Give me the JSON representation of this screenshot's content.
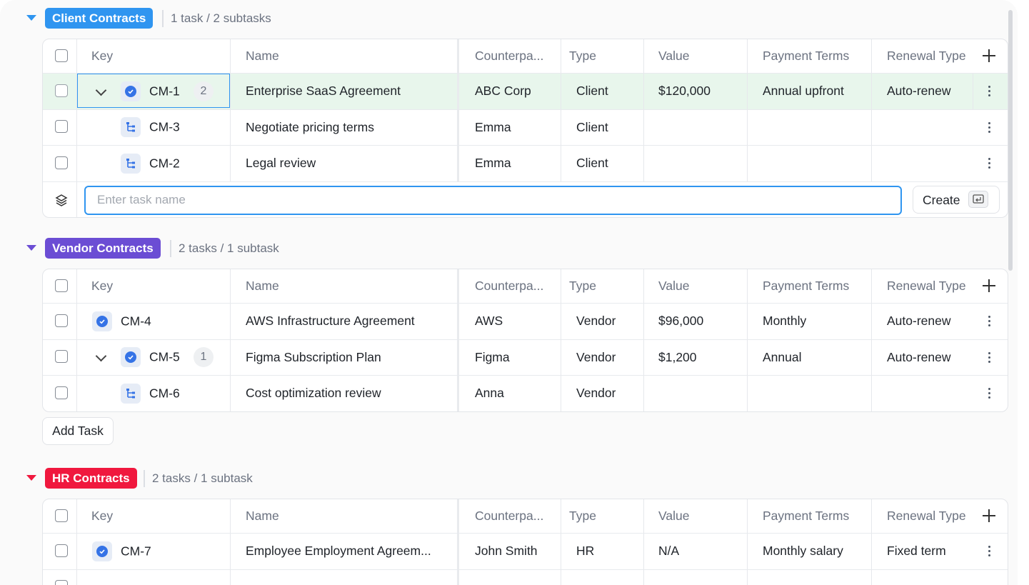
{
  "colors": {
    "accent": "#2f95f0",
    "client_tag": "#2f95f0",
    "vendor_tag": "#6b4dd4",
    "hr_tag": "#f0183e",
    "highlight_row": "#e8f6ec",
    "task_icon": "#3573e6"
  },
  "columns": {
    "key": "Key",
    "name": "Name",
    "counterparty": "Counterpa...",
    "type": "Type",
    "value": "Value",
    "payment_terms": "Payment Terms",
    "renewal_type": "Renewal Type"
  },
  "groups": [
    {
      "tag": "Client Contracts",
      "count": "1 task / 2 subtasks",
      "rows": [
        {
          "key": "CM-1",
          "badge": "2",
          "icon": "task-check-icon",
          "name": "Enterprise SaaS Agreement",
          "counterparty": "ABC Corp",
          "type": "Client",
          "value": "$120,000",
          "payment_terms": "Annual upfront",
          "renewal_type": "Auto-renew"
        },
        {
          "key": "CM-3",
          "icon": "subtask-icon",
          "name": "Negotiate pricing terms",
          "counterparty": "Emma",
          "type": "Client",
          "value": "",
          "payment_terms": "",
          "renewal_type": ""
        },
        {
          "key": "CM-2",
          "icon": "subtask-icon",
          "name": "Legal review",
          "counterparty": "Emma",
          "type": "Client",
          "value": "",
          "payment_terms": "",
          "renewal_type": ""
        }
      ],
      "add_row": {
        "placeholder": "Enter task name",
        "create_label": "Create"
      }
    },
    {
      "tag": "Vendor Contracts",
      "count": "2 tasks / 1 subtask",
      "rows": [
        {
          "key": "CM-4",
          "icon": "task-check-icon",
          "name": "AWS Infrastructure Agreement",
          "counterparty": "AWS",
          "type": "Vendor",
          "value": "$96,000",
          "payment_terms": "Monthly",
          "renewal_type": "Auto-renew"
        },
        {
          "key": "CM-5",
          "badge": "1",
          "icon": "task-check-icon",
          "name": "Figma Subscription Plan",
          "counterparty": "Figma",
          "type": "Vendor",
          "value": "$1,200",
          "payment_terms": "Annual",
          "renewal_type": "Auto-renew"
        },
        {
          "key": "CM-6",
          "icon": "subtask-icon",
          "name": "Cost optimization review",
          "counterparty": "Anna",
          "type": "Vendor",
          "value": "",
          "payment_terms": "",
          "renewal_type": ""
        }
      ],
      "add_task_label": "Add Task"
    },
    {
      "tag": "HR Contracts",
      "count": "2 tasks / 1 subtask",
      "rows": [
        {
          "key": "CM-7",
          "icon": "task-check-icon",
          "name": "Employee Employment Agreem...",
          "counterparty": "John Smith",
          "type": "HR",
          "value": "N/A",
          "payment_terms": "Monthly salary",
          "renewal_type": "Fixed term"
        }
      ]
    }
  ]
}
